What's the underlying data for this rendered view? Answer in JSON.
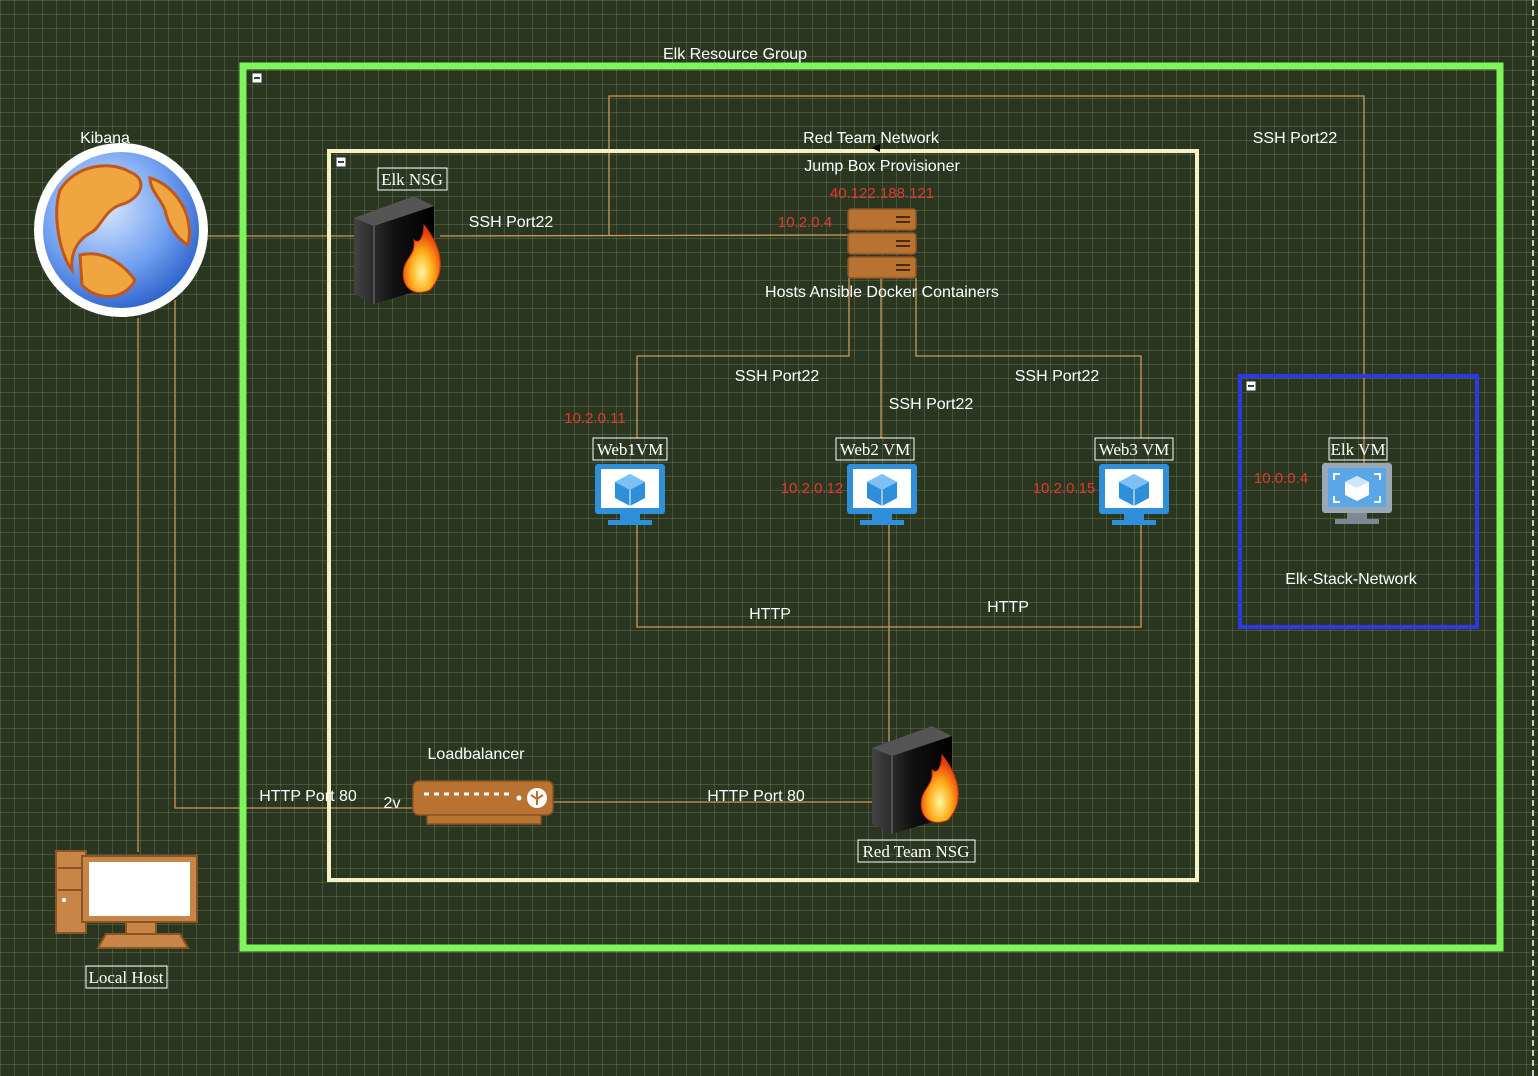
{
  "groups": {
    "resource_group": {
      "label": "Elk Resource Group",
      "border_color": "#7ef55a"
    },
    "red_team_network": {
      "label": "Red Team Network",
      "border_color": "#f5f2c8"
    },
    "elk_stack_network": {
      "label": "Elk-Stack-Network",
      "border_color": "#2b3ae6"
    }
  },
  "nodes": {
    "kibana": {
      "label": "Kibana",
      "icon": "globe-icon"
    },
    "local_host": {
      "label": "Local Host",
      "icon": "desktop-computer-icon"
    },
    "elk_nsg": {
      "label": "Elk NSG",
      "icon": "firewall-icon"
    },
    "red_team_nsg": {
      "label": "Red Team NSG",
      "icon": "firewall-icon"
    },
    "jump_box": {
      "title": "Jump Box Provisioner",
      "public_ip": "40.122.188.121",
      "private_ip": "10.2.0.4",
      "description": "Hosts Ansible Docker Containers",
      "icon": "server-icon"
    },
    "web1": {
      "label": "Web1VM",
      "ip": "10.2.0.11",
      "icon": "vm-icon"
    },
    "web2": {
      "label": "Web2 VM",
      "ip": "10.2.0.12",
      "icon": "vm-icon"
    },
    "web3": {
      "label": "Web3 VM",
      "ip": "10.2.0.15",
      "icon": "vm-icon"
    },
    "elk_vm": {
      "label": "Elk VM",
      "ip": "10.0.0.4",
      "icon": "vm-icon"
    },
    "loadbalancer": {
      "label": "Loadbalancer",
      "tag": "2v",
      "icon": "load-balancer-icon"
    }
  },
  "edges": {
    "ssh_elk_nsg_jumpbox": "SSH Port22",
    "ssh_jumpbox_elkvm": "SSH Port22",
    "ssh_web1": "SSH Port22",
    "ssh_web2": "SSH Port22",
    "ssh_web3": "SSH Port22",
    "http_web1": "HTTP",
    "http_web3": "HTTP",
    "http_port80_localhost": "HTTP Port 80",
    "http_port80_nsg": "HTTP Port 80"
  },
  "colors": {
    "wire": "#c89a5c",
    "ip_text": "#e0392e",
    "device_brown": "#b87333",
    "vm_blue": "#2f8fd8"
  }
}
